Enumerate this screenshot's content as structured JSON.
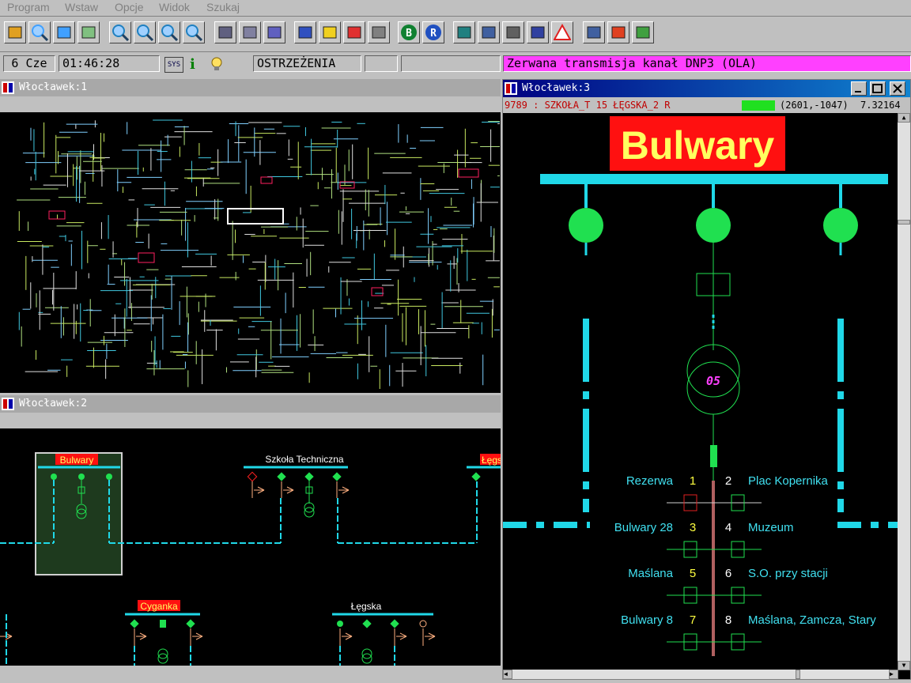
{
  "menu": [
    "Program",
    "Wstaw",
    "Opcje",
    "Widok",
    "Szukaj"
  ],
  "toolbar": {
    "buttons": [
      "open-icon",
      "zoom-window-icon",
      "select-icon",
      "edit-icon",
      "zoom-in-icon",
      "zoom-out-icon",
      "zoom-fit-icon",
      "zoom-previous-icon",
      "pen-icon",
      "move-icon",
      "rotate-icon",
      "layer-blue-icon",
      "layer-yellow-icon",
      "layer-red-icon",
      "layer-clear-icon",
      "b-icon",
      "r-icon",
      "fraction-icon",
      "user-icon",
      "list-icon",
      "sign-icon",
      "warning-icon",
      "window-icon",
      "sound-icon",
      "help-icon"
    ],
    "b_label": "B",
    "r_label": "R"
  },
  "status": {
    "date": "6 Cze",
    "time": "01:46:28",
    "sys_label": "SYS",
    "info_label": "i",
    "warnings": "OSTRZEŻENIA",
    "alarm": "Zerwana transmisja kanał DNP3 (OLA)",
    "colors": {
      "alarm_bg": "#ff40ff"
    }
  },
  "win1": {
    "title": "Włocławek:1"
  },
  "win2": {
    "title": "Włocławek:2",
    "stations": [
      "Bulwary",
      "Szkoła Techniczna",
      "Łęgska",
      "Cyganka",
      "Łęgska"
    ]
  },
  "win3": {
    "title": "Włocławek:3",
    "info": "9789 : SZKOŁA_T 15 ŁĘGSKA_2  R",
    "coords": "(2601,-1047)",
    "zoom": "7.32164",
    "station": "Bulwary",
    "transformer": "05",
    "feeders": [
      {
        "num_left": "1",
        "name_left": "Rezerwa",
        "num_right": "2",
        "name_right": "Plac Kopernika"
      },
      {
        "num_left": "3",
        "name_left": "Bulwary 28",
        "num_right": "4",
        "name_right": "Muzeum"
      },
      {
        "num_left": "5",
        "name_left": "Maślana",
        "num_right": "6",
        "name_right": "S.O. przy stacji"
      },
      {
        "num_left": "7",
        "name_left": "Bulwary 8",
        "num_right": "8",
        "name_right": "Maślana, Zamcza, Stary"
      }
    ],
    "colors": {
      "busbar": "#20d8e8",
      "breaker": "#20e050",
      "station_bg": "#ff1010",
      "station_fg": "#ffff60",
      "feeder_text": "#40e0f0",
      "num_text": "#ffff40"
    }
  }
}
